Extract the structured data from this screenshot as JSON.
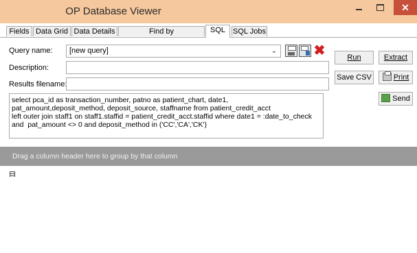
{
  "window": {
    "title": "OP Database Viewer",
    "close_glyph": "✕"
  },
  "tabs": [
    {
      "label": "Fields"
    },
    {
      "label": "Data Grid"
    },
    {
      "label": "Data Details"
    },
    {
      "label": "Find by Name/Description"
    },
    {
      "label": "SQL",
      "active": true
    },
    {
      "label": "SQL Jobs"
    }
  ],
  "query": {
    "name_label": "Query name:",
    "name_value": "[new query]",
    "description_label": "Description:",
    "description_value": "",
    "results_label": "Results filename:",
    "results_value": "",
    "sql_text": "select pca_id as transaction_number, patno as patient_chart, date1,\npat_amount,deposit_method, deposit_source, staffname from patient_credit_acct\nleft outer join staff1 on staff1.staffid = patient_credit_acct.staffid where date1 = :date_to_check\nand  pat_amount <> 0 and deposit_method in ('CC','CA','CK')"
  },
  "icons": {
    "save": "save-icon",
    "save_as": "save-as-icon",
    "delete": "delete-icon",
    "delete_glyph": "✖",
    "combo_glyph": "⌄"
  },
  "buttons": {
    "run": "Run",
    "extract": "Extract",
    "save_csv": "Save CSV",
    "print": "Print",
    "send": "Send"
  },
  "grid": {
    "group_hint": "Drag a column header here to group by that column"
  },
  "colors": {
    "titlebar": "#f6c89e",
    "close": "#c7503b",
    "group_area": "#9a9a9a"
  }
}
